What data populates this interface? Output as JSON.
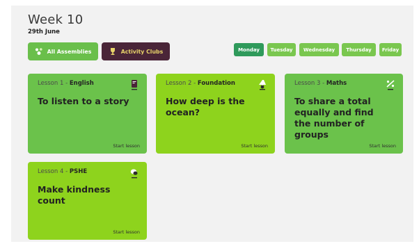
{
  "header": {
    "title": "Week 10",
    "date": "29th June"
  },
  "filters": {
    "all_assemblies": "All Assemblies",
    "activity_clubs": "Activity Clubs"
  },
  "days": [
    {
      "label": "Monday",
      "active": true
    },
    {
      "label": "Tuesday",
      "active": false
    },
    {
      "label": "Wednesday",
      "active": false
    },
    {
      "label": "Thursday",
      "active": false
    },
    {
      "label": "Friday",
      "active": false
    }
  ],
  "lessons": [
    {
      "number": "Lesson 1",
      "separator": " - ",
      "subject": "English",
      "title": "To listen to a story",
      "action": "Start lesson",
      "icon": "book-icon"
    },
    {
      "number": "Lesson 2",
      "separator": " - ",
      "subject": "Foundation",
      "title": "How deep is the ocean?",
      "action": "Start lesson",
      "icon": "lamp-icon"
    },
    {
      "number": "Lesson 3",
      "separator": " - ",
      "subject": "Maths",
      "title": "To share a total equally and find the number of groups",
      "action": "Start lesson",
      "icon": "percent-icon"
    },
    {
      "number": "Lesson 4",
      "separator": " - ",
      "subject": "PSHE",
      "title": "Make kindness count",
      "action": "Start lesson",
      "icon": "chat-icon"
    }
  ],
  "colors": {
    "panel": "#f2f2f2",
    "green": "#6bc24b",
    "lime": "#8ed31d",
    "day": "#7ac74f",
    "day_active": "#2f9a5b",
    "club": "#4a2538"
  }
}
